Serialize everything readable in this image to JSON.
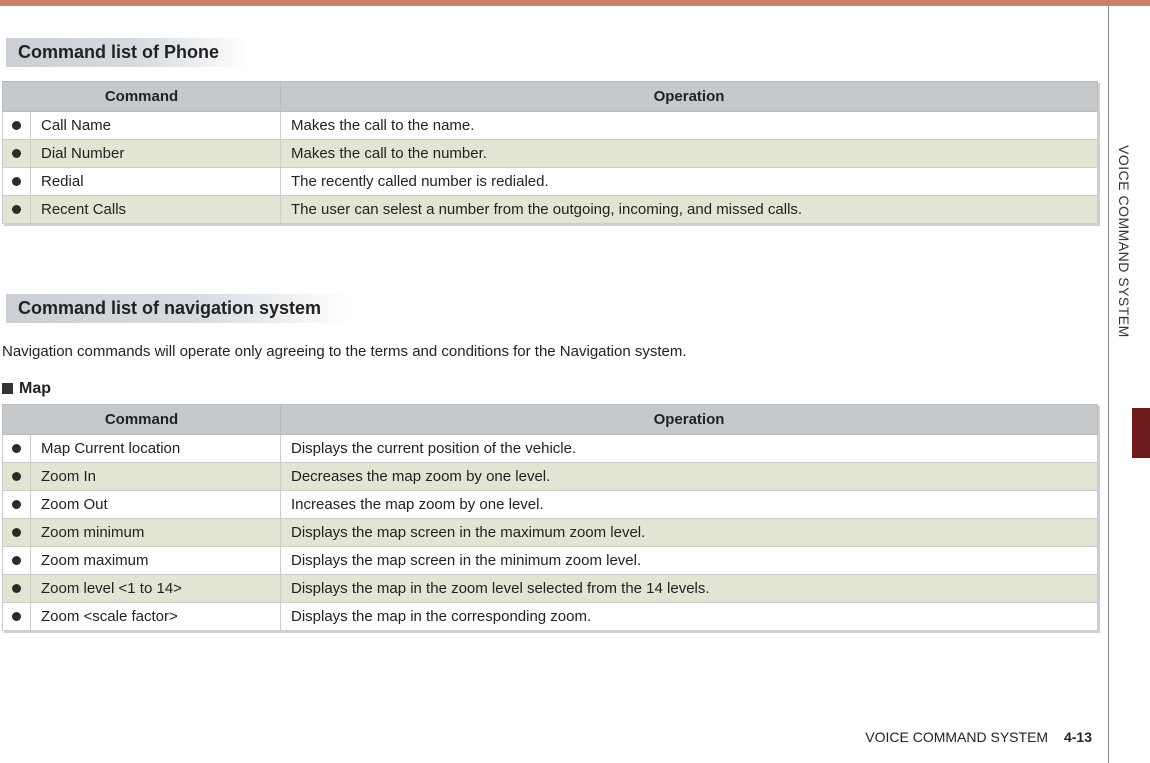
{
  "sideTab": {
    "label": "VOICE COMMAND SYSTEM"
  },
  "sections": {
    "phone": {
      "heading": "Command list of Phone",
      "headers": {
        "command": "Command",
        "operation": "Operation"
      },
      "rows": [
        {
          "command": "Call Name",
          "operation": "Makes the call to the name."
        },
        {
          "command": "Dial Number",
          "operation": "Makes the call to the number."
        },
        {
          "command": "Redial",
          "operation": "The recently called number is redialed."
        },
        {
          "command": "Recent Calls",
          "operation": "The user can selest a number from the outgoing, incoming, and missed calls."
        }
      ]
    },
    "nav": {
      "heading": "Command list of navigation system",
      "note": "Navigation commands will operate only agreeing to the terms and  conditions for the Navigation system.",
      "subhead": "Map",
      "headers": {
        "command": "Command",
        "operation": "Operation"
      },
      "rows": [
        {
          "command": "Map Current location",
          "operation": "Displays the current position of the vehicle."
        },
        {
          "command": "Zoom In",
          "operation": "Decreases the map zoom by one level."
        },
        {
          "command": "Zoom Out",
          "operation": "Increases the map zoom by one level."
        },
        {
          "command": "Zoom minimum",
          "operation": "Displays the map screen in the maximum zoom level."
        },
        {
          "command": "Zoom maximum",
          "operation": "Displays the map screen in the minimum zoom level."
        },
        {
          "command": "Zoom level <1 to 14>",
          "operation": "Displays the map in the zoom level selected from the 14 levels."
        },
        {
          "command": "Zoom <scale factor>",
          "operation": "Displays the map in the corresponding zoom."
        }
      ]
    }
  },
  "footer": {
    "title": "VOICE COMMAND SYSTEM",
    "page": "4-13"
  }
}
